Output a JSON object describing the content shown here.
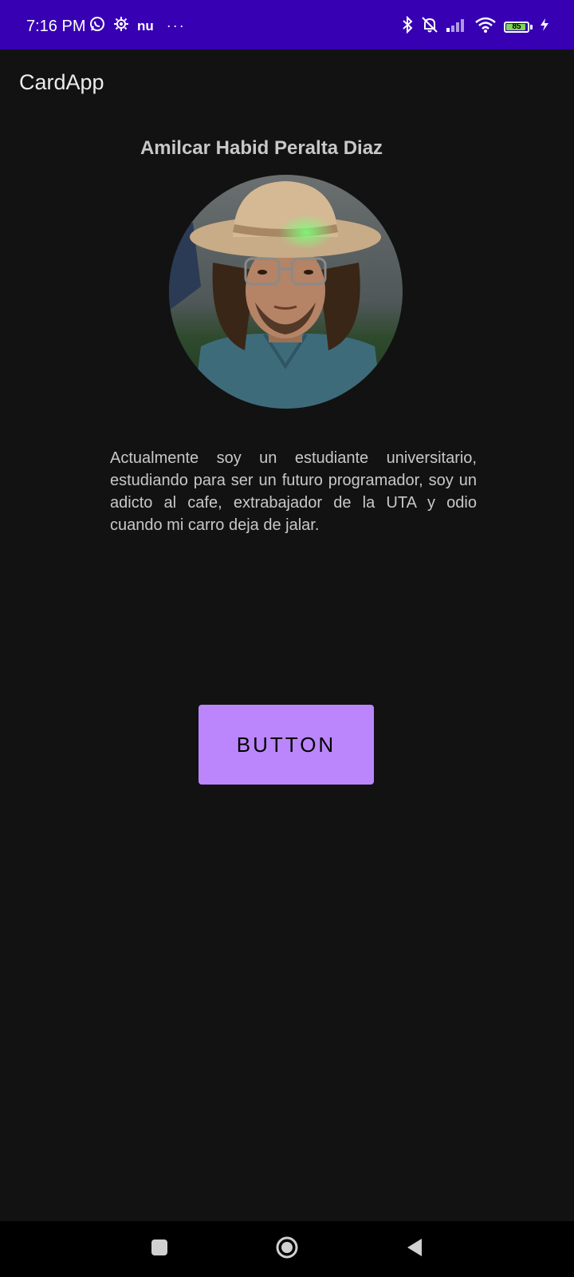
{
  "status_bar": {
    "time": "7:16 PM",
    "left_icons": [
      "whatsapp-icon",
      "settings-icon",
      "nu-icon",
      "more-notifications-icon"
    ],
    "nu_label": "nu",
    "more_label": "···",
    "right_icons": [
      "bluetooth-icon",
      "silent-icon",
      "signal-icon",
      "wifi-icon",
      "battery-icon",
      "charging-icon"
    ],
    "battery_level": "85",
    "battery_color": "#7ed957",
    "background_color": "#3700b3"
  },
  "app_bar": {
    "title": "CardApp"
  },
  "profile": {
    "name": "Amilcar Habid Peralta Diaz",
    "description": "Actualmente soy un estudiante universitario, estudiando para ser un futuro programador, soy un adicto al cafe, extrabajador de la UTA y odio cuando mi carro deja de jalar."
  },
  "actions": {
    "button_label": "BUTTON",
    "button_color": "#bb86fc"
  },
  "navigation": {
    "items": [
      "recents-button",
      "home-button",
      "back-button"
    ]
  }
}
